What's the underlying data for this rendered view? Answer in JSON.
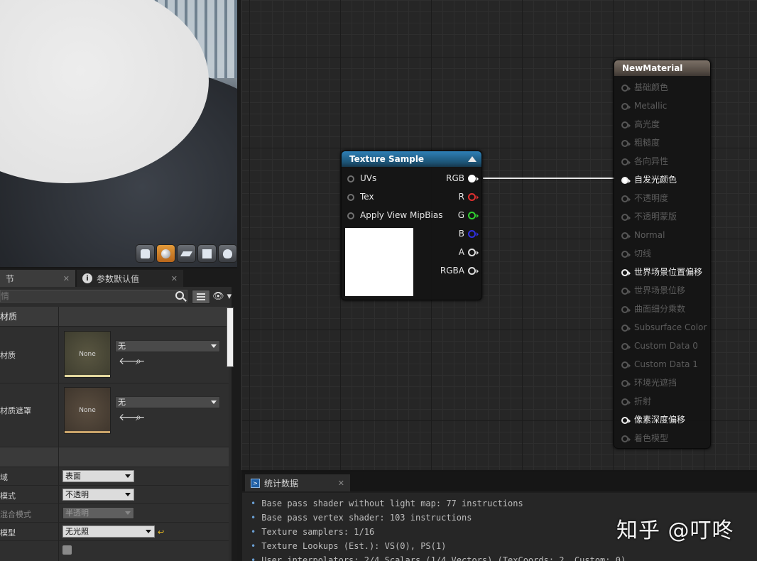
{
  "viewport": {
    "buttons": [
      "cylinder-icon",
      "sphere-icon",
      "plane-icon",
      "cube-icon",
      "teapot-icon"
    ]
  },
  "details": {
    "tab1": {
      "label": "节"
    },
    "tab2": {
      "label": "参数默认值"
    },
    "search": {
      "placeholder": "情"
    },
    "sections": {
      "material": "材质",
      "other": ""
    },
    "props": {
      "material_tex": {
        "label": "材质",
        "thumb": "None",
        "value": "无"
      },
      "material_mask": {
        "label": "材质遮罩",
        "thumb": "None",
        "value": "无"
      },
      "domain": {
        "label": "域",
        "value": "表面"
      },
      "blend": {
        "label": "模式",
        "value": "不透明"
      },
      "decal_blend": {
        "label": "混合模式",
        "value": "半透明"
      },
      "shading": {
        "label": "模型",
        "value": "无光照"
      }
    }
  },
  "graph": {
    "texture_node": {
      "title": "Texture Sample",
      "inputs": [
        "UVs",
        "Tex",
        "Apply View MipBias"
      ],
      "outputs": [
        "RGB",
        "R",
        "G",
        "B",
        "A",
        "RGBA"
      ]
    },
    "material_node": {
      "title": "NewMaterial",
      "pins": [
        {
          "label": "基础颜色",
          "state": "dim"
        },
        {
          "label": "Metallic",
          "state": "dim"
        },
        {
          "label": "高光度",
          "state": "dim"
        },
        {
          "label": "粗糙度",
          "state": "dim"
        },
        {
          "label": "各向异性",
          "state": "dim"
        },
        {
          "label": "自发光颜色",
          "state": "connected"
        },
        {
          "label": "不透明度",
          "state": "dim"
        },
        {
          "label": "不透明蒙版",
          "state": "dim"
        },
        {
          "label": "Normal",
          "state": "dim"
        },
        {
          "label": "切线",
          "state": "dim"
        },
        {
          "label": "世界场景位置偏移",
          "state": "on"
        },
        {
          "label": "世界场景位移",
          "state": "dim"
        },
        {
          "label": "曲面细分乘数",
          "state": "dim"
        },
        {
          "label": "Subsurface Color",
          "state": "dim"
        },
        {
          "label": "Custom Data 0",
          "state": "dim"
        },
        {
          "label": "Custom Data 1",
          "state": "dim"
        },
        {
          "label": "环境光遮挡",
          "state": "dim"
        },
        {
          "label": "折射",
          "state": "dim"
        },
        {
          "label": "像素深度偏移",
          "state": "on"
        },
        {
          "label": "着色模型",
          "state": "dim"
        }
      ]
    }
  },
  "stats": {
    "tab_label": "统计数据",
    "lines": [
      "Base pass shader without light map: 77 instructions",
      "Base pass vertex shader: 103 instructions",
      "Texture samplers: 1/16",
      "Texture Lookups (Est.): VS(0), PS(1)",
      "User interpolators: 2/4 Scalars (1/4 Vectors) (TexCoords: 2, Custom: 0)"
    ]
  },
  "watermark": "知乎 @叮咚",
  "colors": {
    "texture_header": "#2e7fb6",
    "material_header": "#7b7066",
    "pin_r": "#e03030",
    "pin_g": "#30d030",
    "pin_b": "#3030e0"
  }
}
